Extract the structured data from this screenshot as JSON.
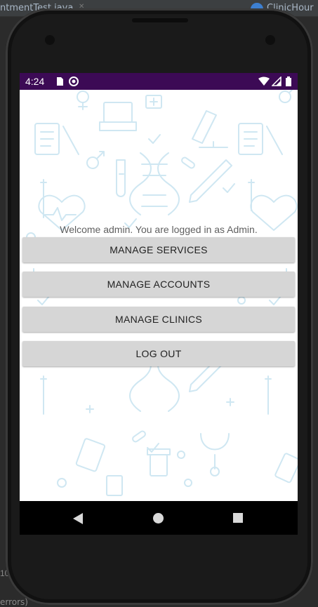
{
  "ide": {
    "left_tab": "ntmentTest.java",
    "right_tab": "ClinicHour",
    "footer_text": "errors)",
    "footer_num": "10."
  },
  "statusbar": {
    "time": "4:24",
    "bg_color": "#3c0a55"
  },
  "screen": {
    "welcome_text": "Welcome admin. You are logged in as Admin.",
    "buttons": [
      {
        "label": "MANAGE SERVICES"
      },
      {
        "label": "MANAGE ACCOUNTS"
      },
      {
        "label": "MANAGE CLINICS"
      },
      {
        "label": "LOG OUT"
      }
    ],
    "pattern_color": "#cfe7f2"
  },
  "navbar": {
    "icons": [
      "back-icon",
      "home-icon",
      "recents-icon"
    ]
  }
}
